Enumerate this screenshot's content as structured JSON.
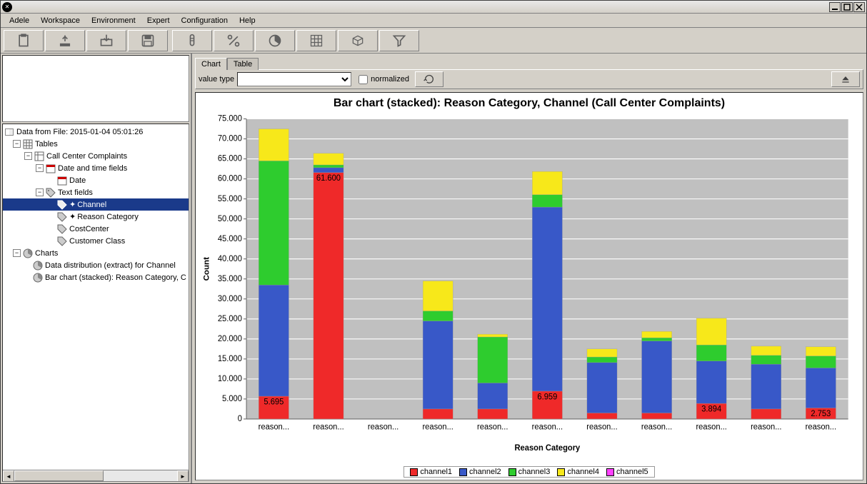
{
  "menus": [
    "Adele",
    "Workspace",
    "Environment",
    "Expert",
    "Configuration",
    "Help"
  ],
  "tree": {
    "root_label": "Data from File: 2015-01-04 05:01:26",
    "tables_label": "Tables",
    "dataset_label": "Call Center Complaints",
    "datetime_group": "Date and time fields",
    "date_field": "Date",
    "text_group": "Text fields",
    "channel_field": "Channel",
    "reason_field": "Reason Category",
    "costcenter_field": "CostCenter",
    "custclass_field": "Customer Class",
    "charts_label": "Charts",
    "chart1": "Data distribution (extract) for Channel",
    "chart2": "Bar chart (stacked): Reason Category, C"
  },
  "tabs": {
    "chart": "Chart",
    "table": "Table"
  },
  "chartbar": {
    "value_type_label": "value type",
    "normalized_label": "normalized"
  },
  "chart_title": "Bar chart (stacked): Reason Category, Channel (Call Center Complaints)",
  "legend": [
    "channel1",
    "channel2",
    "channel3",
    "channel4",
    "channel5"
  ],
  "colors": {
    "channel1": "#ef2929",
    "channel2": "#3858c8",
    "channel3": "#2ecc2e",
    "channel4": "#f7e81a",
    "channel5": "#ff40ff"
  },
  "chart_data": {
    "type": "bar",
    "title": "Bar chart (stacked): Reason Category, Channel (Call Center Complaints)",
    "xlabel": "Reason Category",
    "ylabel": "Count",
    "ylim": [
      0,
      75000
    ],
    "yticks": [
      0,
      5000,
      10000,
      15000,
      20000,
      25000,
      30000,
      35000,
      40000,
      45000,
      50000,
      55000,
      60000,
      65000,
      70000,
      75000
    ],
    "categories": [
      "reason...",
      "reason...",
      "reason...",
      "reason...",
      "reason...",
      "reason...",
      "reason...",
      "reason...",
      "reason...",
      "reason...",
      "reason..."
    ],
    "series": [
      {
        "name": "channel1",
        "values": [
          5695,
          61600,
          0,
          2500,
          2500,
          6959,
          1500,
          1500,
          3894,
          2500,
          2753
        ]
      },
      {
        "name": "channel2",
        "values": [
          27800,
          1200,
          0,
          22000,
          6500,
          46000,
          12600,
          18000,
          10600,
          11200,
          10000
        ]
      },
      {
        "name": "channel3",
        "values": [
          31000,
          700,
          0,
          2500,
          11500,
          3100,
          1400,
          800,
          4000,
          2200,
          3000
        ]
      },
      {
        "name": "channel4",
        "values": [
          8000,
          2900,
          0,
          7500,
          700,
          5800,
          2000,
          1600,
          6700,
          2300,
          2300
        ]
      },
      {
        "name": "channel5",
        "values": [
          0,
          0,
          0,
          0,
          0,
          0,
          0,
          0,
          0,
          0,
          0
        ]
      }
    ],
    "bar_labels": {
      "0": "5.695",
      "1": "61.600",
      "5": "6.959",
      "8": "3.894",
      "10": "2.753"
    }
  }
}
